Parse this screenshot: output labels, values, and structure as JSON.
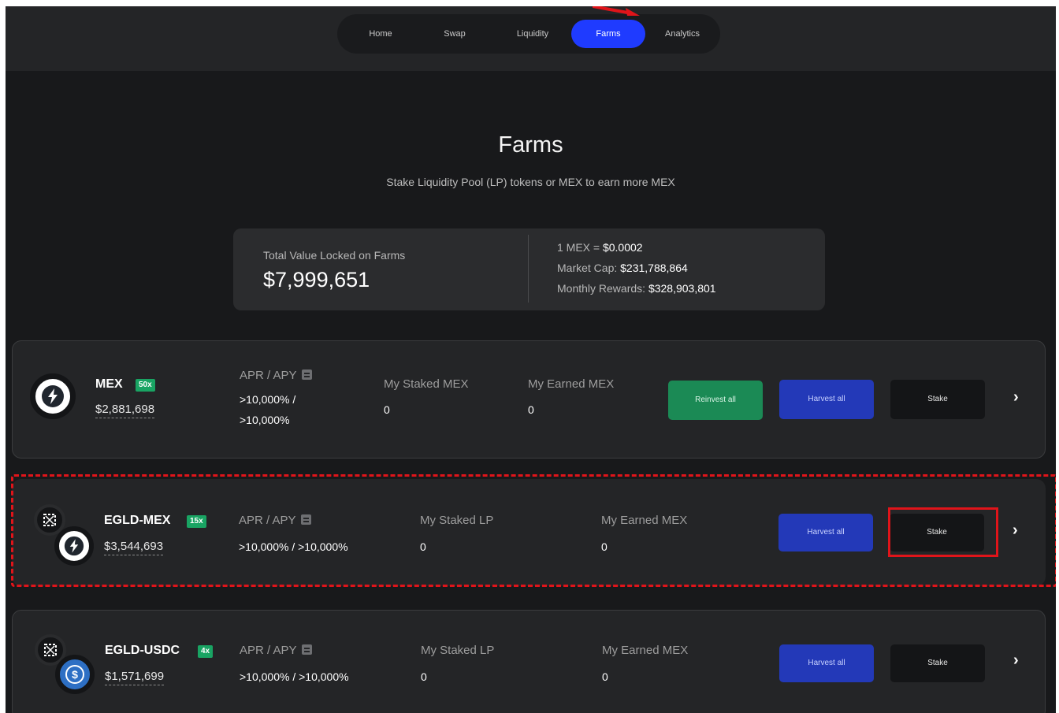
{
  "nav": {
    "items": [
      {
        "label": "Home",
        "active": false
      },
      {
        "label": "Swap",
        "active": false
      },
      {
        "label": "Liquidity",
        "active": false
      },
      {
        "label": "Farms",
        "active": true
      },
      {
        "label": "Analytics",
        "active": false
      }
    ]
  },
  "header": {
    "title": "Farms",
    "subtitle": "Stake Liquidity Pool (LP) tokens or MEX to earn more MEX"
  },
  "stats": {
    "tvl_label": "Total Value Locked on Farms",
    "tvl_value": "$7,999,651",
    "price_label": "1 MEX = ",
    "price_value": "$0.0002",
    "market_cap_label": "Market Cap: ",
    "market_cap_value": "$231,788,864",
    "monthly_rewards_label": "Monthly Rewards: ",
    "monthly_rewards_value": "$328,903,801"
  },
  "farms": [
    {
      "name": "MEX",
      "multiplier": "50x",
      "tvl": "$2,881,698",
      "apr_label": "APR / APY",
      "apr_line1": ">10,000% /",
      "apr_line2": ">10,000%",
      "staked_label": "My Staked MEX",
      "staked_value": "0",
      "earned_label": "My Earned MEX",
      "earned_value": "0",
      "reinvest_label": "Reinvest all",
      "harvest_label": "Harvest all",
      "stake_label": "Stake"
    },
    {
      "name": "EGLD-MEX",
      "multiplier": "15x",
      "tvl": "$3,544,693",
      "apr_label": "APR / APY",
      "apr_value": ">10,000% / >10,000%",
      "staked_label": "My Staked LP",
      "staked_value": "0",
      "earned_label": "My Earned MEX",
      "earned_value": "0",
      "harvest_label": "Harvest all",
      "stake_label": "Stake"
    },
    {
      "name": "EGLD-USDC",
      "multiplier": "4x",
      "tvl": "$1,571,699",
      "apr_label": "APR / APY",
      "apr_value": ">10,000% / >10,000%",
      "staked_label": "My Staked LP",
      "staked_value": "0",
      "earned_label": "My Earned MEX",
      "earned_value": "0",
      "harvest_label": "Harvest all",
      "stake_label": "Stake"
    }
  ],
  "colors": {
    "background": "#18191b",
    "card": "#242527",
    "nav_active": "#1f3bff",
    "multiplier_badge": "#19a463",
    "reinvest_button": "#1b8a55",
    "harvest_button": "#2339b8",
    "stake_button": "#141517",
    "annotation": "#e0141a"
  }
}
